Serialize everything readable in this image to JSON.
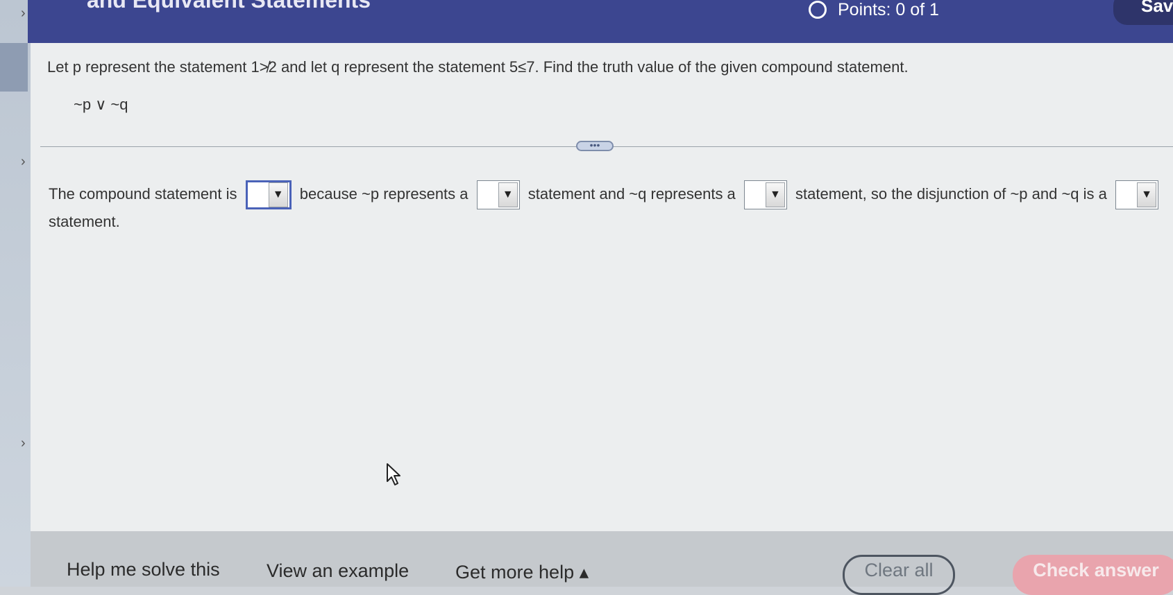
{
  "header": {
    "title": "and Equivalent Statements",
    "points": "Points: 0 of 1",
    "save_label": "Save"
  },
  "question": {
    "prompt": "Let p represent the statement 1≯2 and let q represent the statement 5≤7. Find the truth value of the given compound statement.",
    "expression": "~p ∨ ~q"
  },
  "answer": {
    "part1": "The compound statement is",
    "part2": "because ~p represents a",
    "part3": "statement and ~q represents a",
    "part4": "statement, so the disjunction of ~p and ~q is a",
    "part5": "statement.",
    "dropdown_arrow": "▼"
  },
  "divider": {
    "handle": "•••"
  },
  "footer": {
    "help_me_solve": "Help me solve this",
    "view_example": "View an example",
    "get_more_help": "Get more help ▴",
    "clear_all": "Clear all",
    "check_answer": "Check answer"
  },
  "rail": {
    "chevron": "›"
  },
  "colors": {
    "header_bg": "#3c4690",
    "dropdown_focus": "#4a62b8",
    "check_button": "#e9a4ad"
  }
}
